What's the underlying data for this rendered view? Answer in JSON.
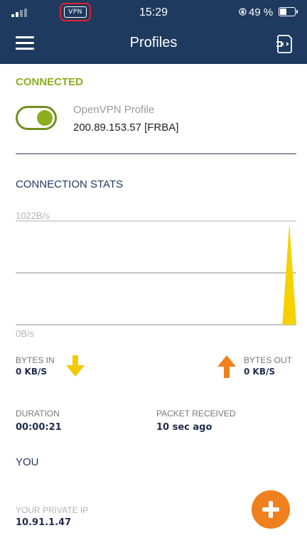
{
  "status_bar": {
    "vpn_badge": "VPN",
    "time": "15:29",
    "battery_percent": "49 %",
    "battery_level": 0.49,
    "icons": [
      "signal-icon",
      "vpn-badge-icon",
      "rotation-lock-icon",
      "battery-icon"
    ]
  },
  "nav": {
    "title": "Profiles",
    "menu_icon": "hamburger-menu-icon",
    "import_icon": "file-import-icon"
  },
  "connection": {
    "status": "CONNECTED",
    "profile_name": "OpenVPN Profile",
    "server": "200.89.153.57 [FRBA]",
    "toggle_on": true
  },
  "stats": {
    "section_title": "CONNECTION STATS",
    "chart_max_label": "1022B/s",
    "chart_min_label": "0B/s",
    "bytes_in_label": "BYTES IN",
    "bytes_in_value": "0 KB/S",
    "bytes_out_label": "BYTES OUT",
    "bytes_out_value": "0 KB/S",
    "duration_label": "DURATION",
    "duration_value": "00:00:21",
    "packet_label": "PACKET RECEIVED",
    "packet_value": "10 sec ago"
  },
  "chart_data": {
    "type": "area",
    "ylim": [
      0,
      1022
    ],
    "y_top_label": "1022B/s",
    "y_bottom_label": "0B/s",
    "values": [
      0,
      0,
      0,
      0,
      0,
      0,
      0,
      0,
      0,
      0,
      0,
      0,
      0,
      0,
      0,
      0,
      0,
      0,
      0,
      0,
      0,
      0,
      0,
      0,
      0,
      0,
      0,
      0,
      0,
      0,
      0,
      0,
      0,
      0,
      0,
      0,
      0,
      0,
      0,
      1000,
      0
    ],
    "series": [
      {
        "values": [
          0,
          1000,
          0
        ],
        "color": "#f5d100"
      }
    ],
    "grid": true
  },
  "you": {
    "section_title": "YOU",
    "private_ip_label": "YOUR PRIVATE IP",
    "private_ip_value": "10.91.1.47",
    "add_icon": "plus-icon"
  },
  "colors": {
    "header_bg": "#1e3a5f",
    "connected_green": "#8cad1e",
    "bytes_in_yellow": "#f5c800",
    "bytes_out_orange": "#f0801e",
    "chart_fill": "#f5d100"
  }
}
